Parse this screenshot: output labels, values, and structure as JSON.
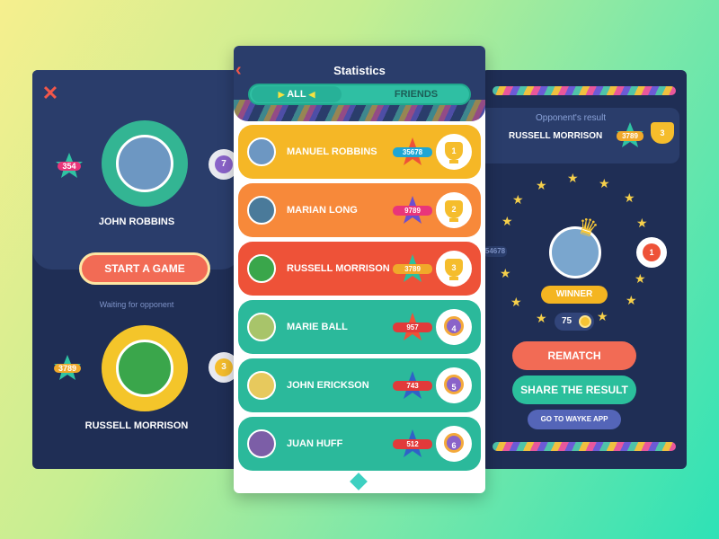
{
  "left": {
    "player1": {
      "name": "JOHN ROBBINS",
      "score": "354",
      "rank": "7"
    },
    "start_label": "START A GAME",
    "waiting_label": "Waiting for opponent",
    "player2": {
      "name": "RUSSELL MORRISON",
      "score": "3789",
      "rank": "3"
    }
  },
  "center": {
    "title": "Statistics",
    "tabs": {
      "all": "ALL",
      "friends": "FRIENDS"
    },
    "rows": [
      {
        "name": "MANUEL ROBBINS",
        "score": "35678",
        "rank": "1",
        "color": "#f5b726"
      },
      {
        "name": "MARIAN LONG",
        "score": "9789",
        "rank": "2",
        "color": "#f7893a"
      },
      {
        "name": "RUSSELL MORRISON",
        "score": "3789",
        "rank": "3",
        "color": "#ee5238"
      },
      {
        "name": "MARIE BALL",
        "score": "957",
        "rank": "4",
        "color": "#2bb99b"
      },
      {
        "name": "JOHN ERICKSON",
        "score": "743",
        "rank": "5",
        "color": "#2bb99b"
      },
      {
        "name": "JUAN HUFF",
        "score": "512",
        "rank": "6",
        "color": "#2bb99b"
      }
    ]
  },
  "right": {
    "opponent_title": "Opponent's result",
    "opponent_name": "RUSSELL MORRISON",
    "opponent_score": "3789",
    "opponent_rank": "3",
    "side_score": "54678",
    "side_rank": "1",
    "winner_label": "WINNER",
    "coins": "75",
    "rematch_label": "REMATCH",
    "share_label": "SHARE THE RESULT",
    "app_label": "GO TO WAYKE APP"
  },
  "colors": {
    "coral": "#f26b55",
    "teal": "#2bbf9c",
    "navy": "#1f2e55",
    "gold": "#f4b521"
  }
}
